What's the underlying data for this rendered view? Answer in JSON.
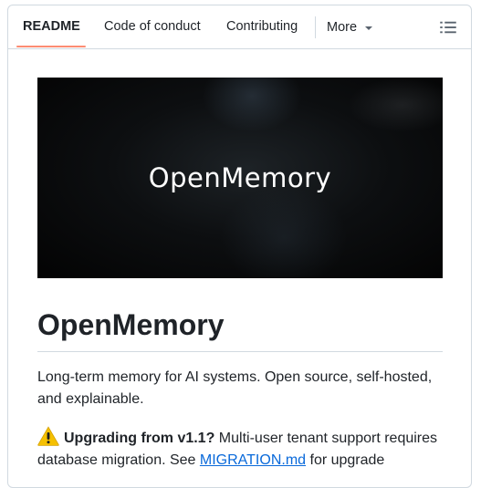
{
  "tabs": {
    "readme": "README",
    "code_of_conduct": "Code of conduct",
    "contributing": "Contributing",
    "more": "More"
  },
  "hero": {
    "title": "OpenMemory"
  },
  "readme": {
    "heading": "OpenMemory",
    "description": "Long-term memory for AI systems. Open source, self-hosted, and explainable.",
    "notice": {
      "icon": "warning-icon",
      "bold_text": "Upgrading from v1.1?",
      "text_before_link": " Multi-user tenant support requires database migration. See ",
      "link_text": "MIGRATION.md",
      "text_after_link": " for upgrade"
    }
  },
  "colors": {
    "accent_underline": "#fd8c73",
    "link": "#0969da",
    "border": "#d1d9e0",
    "text": "#1f2328"
  }
}
